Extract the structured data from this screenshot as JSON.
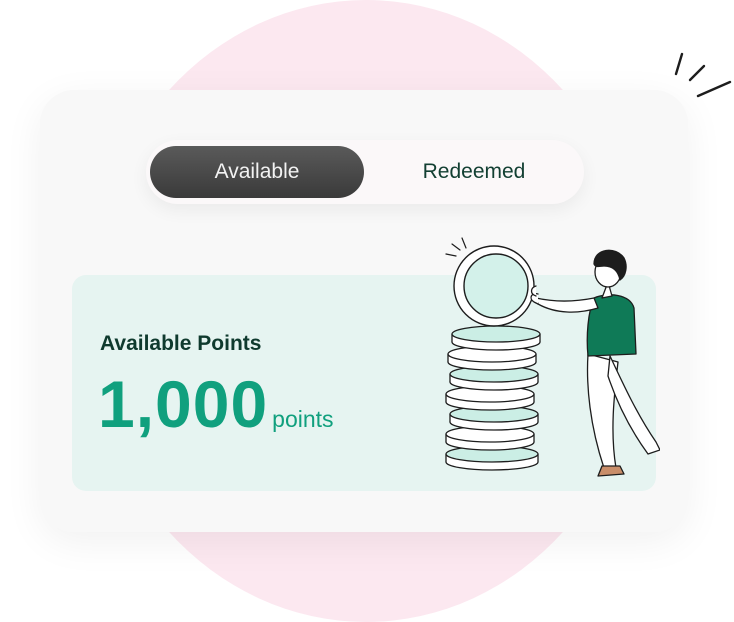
{
  "tabs": {
    "available_label": "Available",
    "redeemed_label": "Redeemed",
    "selected": "Available"
  },
  "points": {
    "label": "Available Points",
    "value": "1,000",
    "unit": "points"
  },
  "colors": {
    "accent": "#10a07e",
    "panel": "#e6f4f1",
    "pink_bg": "#fce8f0",
    "dark_text": "#0f3a2e"
  },
  "illustration": {
    "icon": "person-stacking-coins-illustration"
  }
}
